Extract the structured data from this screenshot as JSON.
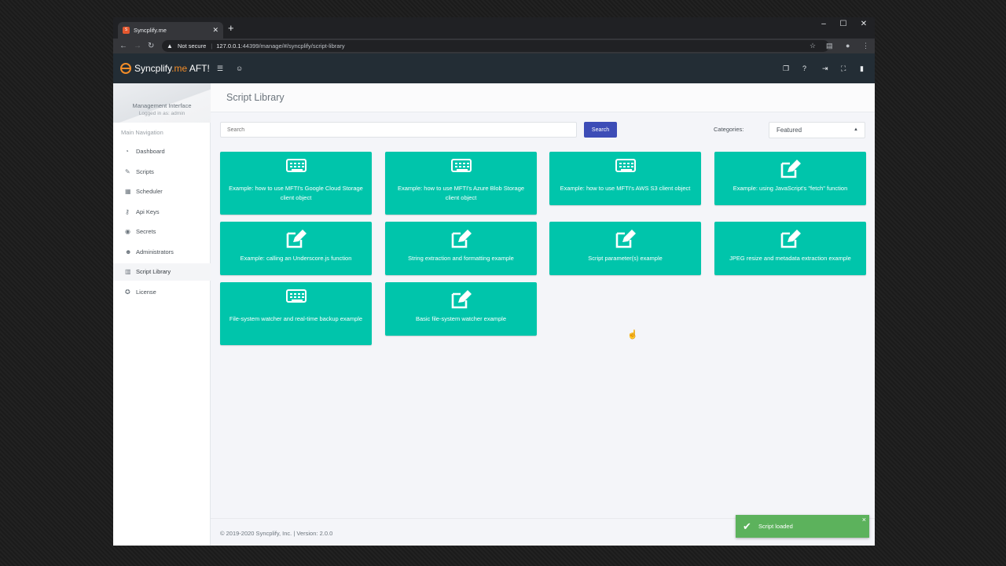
{
  "browser": {
    "tab_title": "Syncplify.me",
    "tab_favicon": "S",
    "new_tab": "+",
    "security_label": "Not secure",
    "url_host": "127.0.0.1",
    "url_rest": ":44399/manage/#/syncplify/script-library",
    "minimize": "–",
    "maximize": "☐",
    "close": "✕"
  },
  "app": {
    "brand_name": "Syncplify",
    "brand_me": ".me",
    "brand_suffix": " AFT!"
  },
  "sidebar": {
    "title": "Management Interface",
    "logged_in": "Logged in as: admin",
    "nav_header": "Main Navigation",
    "items": [
      {
        "label": "Dashboard",
        "icon": "dashboard-icon"
      },
      {
        "label": "Scripts",
        "icon": "pencil-icon"
      },
      {
        "label": "Scheduler",
        "icon": "calendar-icon"
      },
      {
        "label": "Api Keys",
        "icon": "key-icon"
      },
      {
        "label": "Secrets",
        "icon": "eye-icon"
      },
      {
        "label": "Administrators",
        "icon": "users-icon"
      },
      {
        "label": "Script Library",
        "icon": "book-icon",
        "active": true
      },
      {
        "label": "License",
        "icon": "award-icon"
      }
    ]
  },
  "page": {
    "title": "Script Library",
    "search_placeholder": "Search",
    "search_button": "Search",
    "categories_label": "Categories:",
    "category_selected": "Featured"
  },
  "cards": [
    {
      "title": "Example: how to use MFTI's Google Cloud Storage client object",
      "icon": "keyboard-icon"
    },
    {
      "title": "Example: how to use MFTI's Azure Blob Storage client object",
      "icon": "keyboard-icon"
    },
    {
      "title": "Example: how to use MFTI's AWS S3 client object",
      "icon": "keyboard-icon"
    },
    {
      "title": "Example: using JavaScript's \"fetch\" function",
      "icon": "edit-icon"
    },
    {
      "title": "Example: calling an Underscore.js function",
      "icon": "edit-icon"
    },
    {
      "title": "String extraction and formatting example",
      "icon": "edit-icon"
    },
    {
      "title": "Script parameter(s) example",
      "icon": "edit-icon"
    },
    {
      "title": "JPEG resize and metadata extraction example",
      "icon": "edit-icon"
    },
    {
      "title": "File-system watcher and real-time backup example",
      "icon": "keyboard-icon"
    },
    {
      "title": "Basic file-system watcher example",
      "icon": "edit-icon"
    }
  ],
  "footer": {
    "text": "© 2019-2020 Syncplify, Inc. | Version: 2.0.0"
  },
  "toast": {
    "message": "Script loaded",
    "close": "×"
  },
  "colors": {
    "card": "#00c5ab",
    "header": "#232d35",
    "primary_button": "#3d4db7",
    "toast": "#5cb25c",
    "brand_accent": "#f28c28"
  }
}
